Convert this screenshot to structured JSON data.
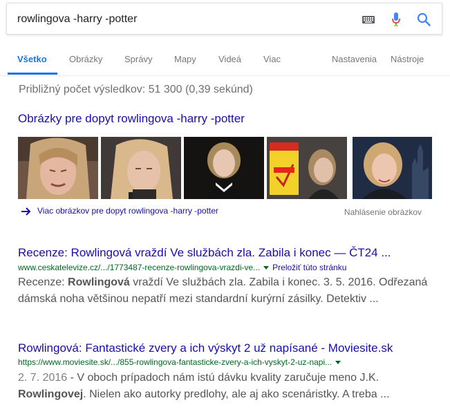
{
  "search": {
    "query": "rowlingova -harry -potter"
  },
  "icons": {
    "keyboard": "keyboard-icon",
    "mic": "mic-icon",
    "search": "search-icon",
    "arrow": "arrow-right-icon",
    "caret": "caret-down-icon"
  },
  "colors": {
    "accent": "#1a73e8",
    "link": "#1a0dab",
    "url": "#006621",
    "mic_red": "#ea4335"
  },
  "tabs": [
    {
      "label": "Všetko",
      "active": true
    },
    {
      "label": "Obrázky"
    },
    {
      "label": "Správy"
    },
    {
      "label": "Mapy"
    },
    {
      "label": "Videá"
    },
    {
      "label": "Viac"
    },
    {
      "label": "Nastavenia"
    },
    {
      "label": "Nástroje"
    }
  ],
  "stats": "Približný počet výsledkov: 51 300 (0,39 sekúnd)",
  "images": {
    "title": "Obrázky pre dopyt rowlingova -harry -potter",
    "more": "Viac obrázkov pre dopyt rowlingova -harry -potter",
    "report": "Nahlásenie obrázkov"
  },
  "results": [
    {
      "title": "Recenze: Rowlingová vraždí Ve službách zla. Zabila i konec — ČT24 ...",
      "url": "www.ceskatelevize.cz/.../1773487-recenze-rowlingova-vrazdi-ve...",
      "translate": "Preložiť túto stránku",
      "snippet_1": "Recenze: ",
      "snippet_bold": "Rowlingová",
      "snippet_2": " vraždí Ve službách zla. Zabila i konec. 3. 5. 2016. Odřezaná dámská noha většinou nepatří mezi standardní kurýrní zásilky. Detektiv ..."
    },
    {
      "title": "Rowlingová: Fantastické zvery a ich výskyt 2 už napísané - Moviesite.sk",
      "url": "https://www.moviesite.sk/.../855-rowlingova-fantasticke-zvery-a-ich-vyskyt-2-uz-napi...",
      "date": "2. 7. 2016",
      "snippet_1": " - V oboch prípadoch nám istú dávku kvality zaručuje meno J.K. ",
      "snippet_bold": "Rowlingovej",
      "snippet_2": ". Nielen ako autorky predlohy, ale aj ako scenáristky. A treba ..."
    }
  ]
}
